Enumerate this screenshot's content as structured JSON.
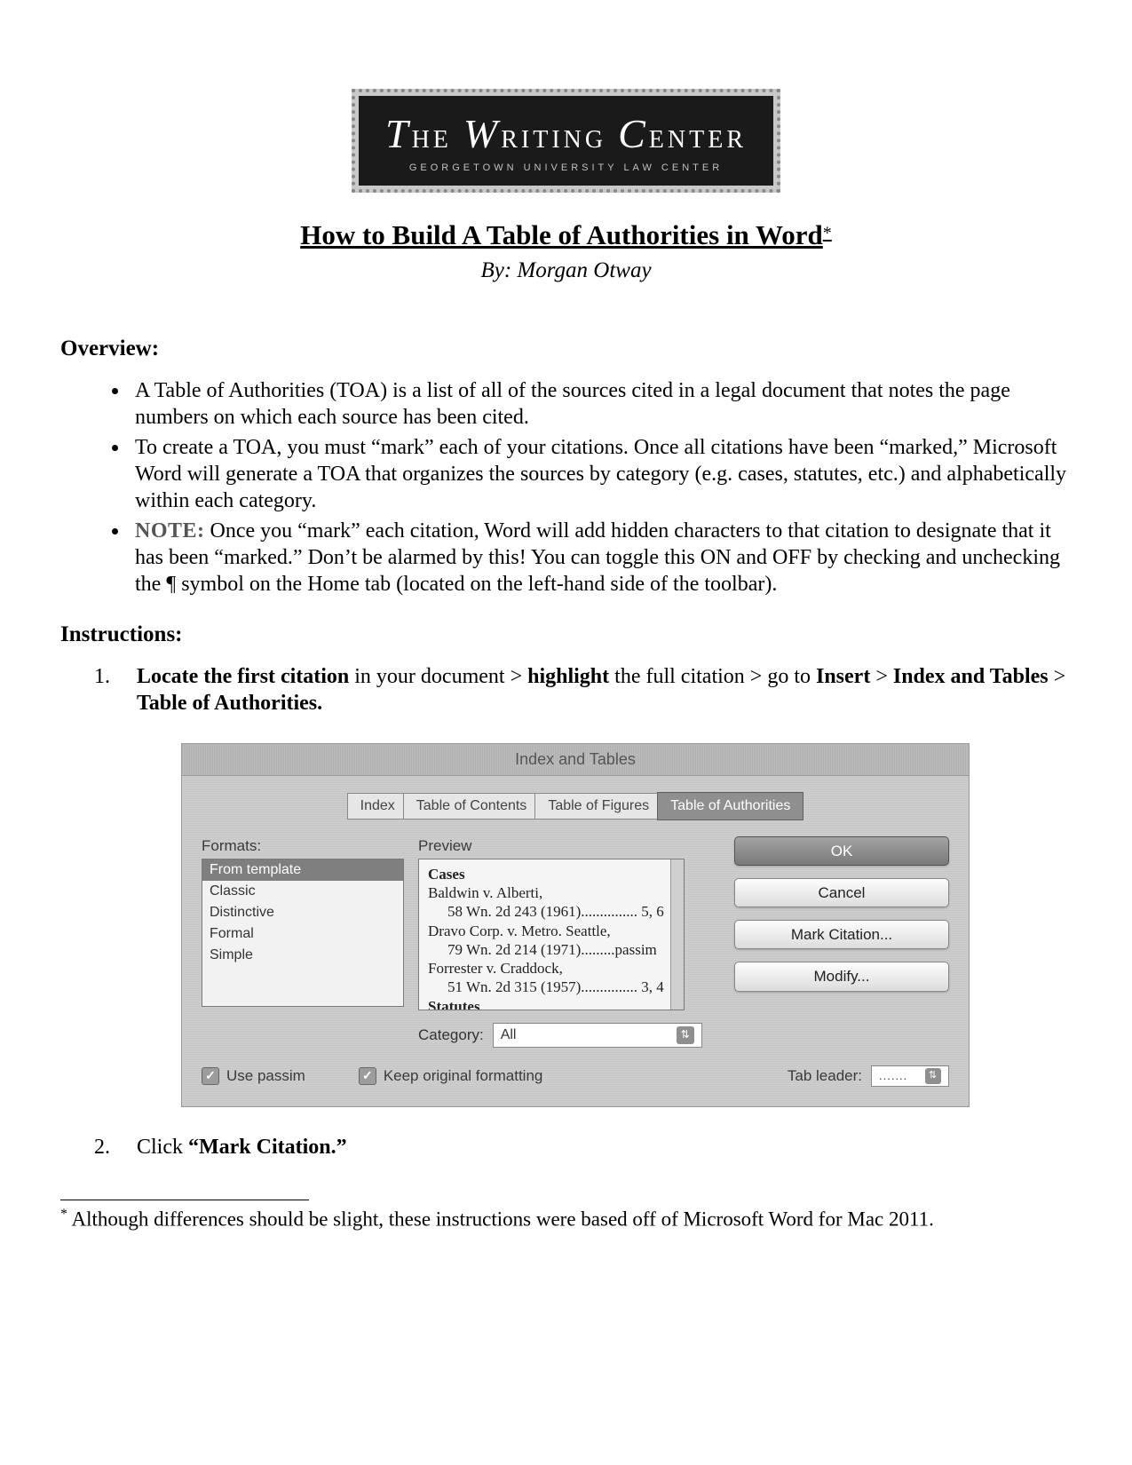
{
  "logo": {
    "main_pre": "T",
    "main_he": "HE",
    "main_w": "W",
    "main_riting": "RITING",
    "main_c": "C",
    "main_enter": "ENTER",
    "sub": "GEORGETOWN UNIVERSITY LAW CENTER"
  },
  "title": "How to Build A Table of Authorities in Word",
  "title_mark": "*",
  "byline": "By: Morgan Otway",
  "overview_heading": "Overview:",
  "overview": [
    "A Table of Authorities (TOA) is a list of all of the sources cited in a legal document that notes the page numbers on which each source has been cited.",
    "To create a TOA, you must “mark” each of your citations. Once all citations have been “marked,” Microsoft Word will generate a TOA that organizes the sources by category (e.g. cases, statutes, etc.) and alphabetically within each category.",
    "Once you “mark” each citation, Word will add hidden characters to that citation to designate that it has been “marked.” Don’t be alarmed by this! You can toggle this ON and OFF by checking and unchecking the ¶ symbol on the Home tab (located on the left-hand side of the toolbar)."
  ],
  "note_label": "NOTE:",
  "instructions_heading": "Instructions:",
  "step1": {
    "p1a": "Locate the first citation",
    "p1b": " in your document > ",
    "p1c": "highlight",
    "p1d": " the full citation > go to ",
    "p1e": "Insert",
    "p1f": " > ",
    "p1g": "Index and Tables",
    "p1h": " > ",
    "p1i": "Table of Authorities."
  },
  "dialog": {
    "title": "Index and Tables",
    "tabs": [
      "Index",
      "Table of Contents",
      "Table of Figures",
      "Table of Authorities"
    ],
    "formats_label": "Formats:",
    "formats": [
      "From template",
      "Classic",
      "Distinctive",
      "Formal",
      "Simple"
    ],
    "preview_label": "Preview",
    "preview": {
      "h1": "Cases",
      "l1": "Baldwin v. Alberti,",
      "l1b": "58 Wn. 2d 243 (1961)............... 5, 6",
      "l2": "Dravo Corp. v. Metro. Seattle,",
      "l2b": "79 Wn. 2d 214 (1971).........passim",
      "l3": "Forrester v. Craddock,",
      "l3b": "51 Wn. 2d 315 (1957)............... 3, 4",
      "h2": "Statutes"
    },
    "buttons": {
      "ok": "OK",
      "cancel": "Cancel",
      "mark": "Mark Citation...",
      "modify": "Modify..."
    },
    "category_label": "Category:",
    "category_value": "All",
    "use_passim": "Use passim",
    "keep_fmt": "Keep original formatting",
    "tab_leader_label": "Tab leader:",
    "tab_leader_value": "......."
  },
  "step2": {
    "a": "Click ",
    "b": "“Mark Citation.”"
  },
  "footnote_mark": "*",
  "footnote_text": " Although differences should be slight, these instructions were based off of Microsoft Word for Mac 2011."
}
